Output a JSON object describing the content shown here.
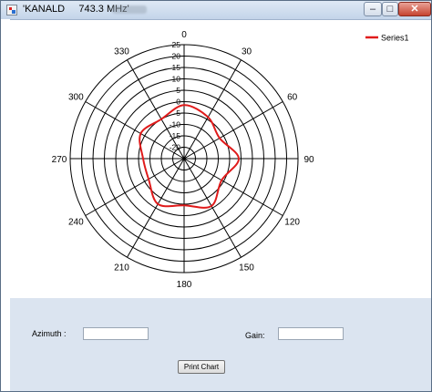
{
  "window": {
    "title": "'KANALD     743.3 MHz'",
    "minimize_glyph": "–",
    "maximize_glyph": "□",
    "close_glyph": "✕"
  },
  "chart_data": {
    "type": "polar",
    "angle_labels": [
      "0",
      "30",
      "60",
      "90",
      "120",
      "150",
      "180",
      "210",
      "240",
      "270",
      "300",
      "330"
    ],
    "radial_labels": [
      "25",
      "20",
      "15",
      "10",
      "5",
      "0",
      "-5",
      "-10",
      "-15",
      "-20"
    ],
    "radial_range": [
      -25,
      25
    ],
    "legend": {
      "position": "top-right",
      "entries": [
        {
          "name": "Series1",
          "color": "#e01b1b"
        }
      ]
    },
    "series": [
      {
        "name": "Series1",
        "color": "#e01b1b",
        "angles": [
          0,
          30,
          60,
          90,
          120,
          150,
          180,
          210,
          240,
          270,
          300,
          330,
          360
        ],
        "gain": [
          -1.5,
          -4,
          -7,
          -1,
          -6,
          -1,
          -4.5,
          -2,
          -7,
          -7,
          -3,
          -5,
          -1.5
        ]
      }
    ]
  },
  "form": {
    "azimuth_label": "Azimuth :",
    "azimuth_value": "",
    "gain_label": "Gain:",
    "gain_value": "",
    "print_button": "Print Chart"
  },
  "colors": {
    "panel": "#dbe4f0",
    "series": "#e01b1b"
  }
}
